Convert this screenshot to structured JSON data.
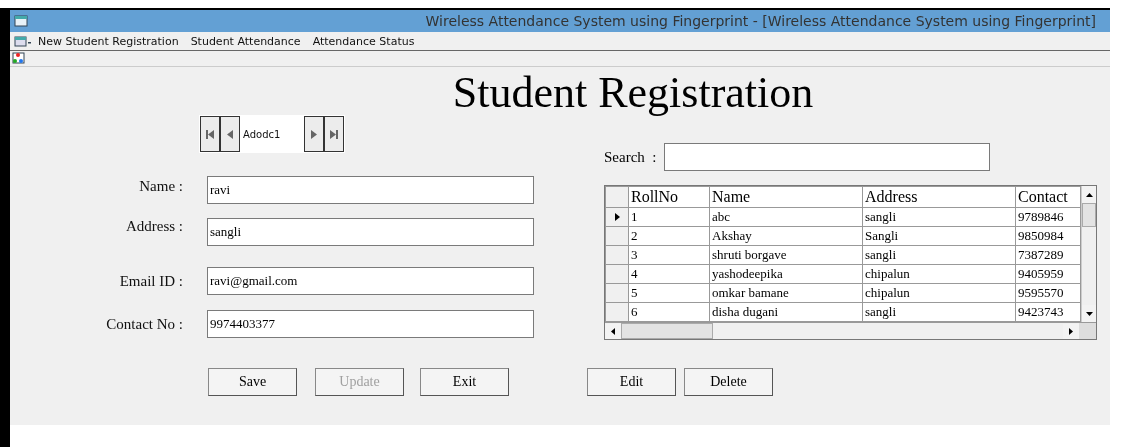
{
  "window": {
    "title": "Wireless Attendance System using Fingerprint - [Wireless Attendance System using Fingerprint]"
  },
  "menu": [
    "New Student Registration",
    "Student Attendance",
    "Attendance Status"
  ],
  "form_title": "Student Registration",
  "data_control": {
    "caption": "Adodc1"
  },
  "fields": [
    {
      "label": "Name :",
      "value": "ravi"
    },
    {
      "label": "Address :",
      "value": "sangli"
    },
    {
      "label": "Email ID :",
      "value": "ravi@gmail.com"
    },
    {
      "label": "Contact No :",
      "value": "9974403377"
    }
  ],
  "search": {
    "label": "Search  :"
  },
  "grid": {
    "columns": [
      "RollNo",
      "Name",
      "Address",
      "Contact"
    ],
    "rows": [
      {
        "selected": true,
        "cells": [
          "1",
          "abc",
          "sangli",
          "9789846"
        ]
      },
      {
        "selected": false,
        "cells": [
          "2",
          "Akshay",
          "Sangli",
          "9850984"
        ]
      },
      {
        "selected": false,
        "cells": [
          "3",
          "shruti borgave",
          "sangli",
          "7387289"
        ]
      },
      {
        "selected": false,
        "cells": [
          "4",
          "yashodeepika",
          "chipalun",
          "9405959"
        ]
      },
      {
        "selected": false,
        "cells": [
          "5",
          "omkar bamane",
          "chipalun",
          "9595570"
        ]
      },
      {
        "selected": false,
        "cells": [
          "6",
          "disha dugani",
          "sangli",
          "9423743"
        ]
      }
    ]
  },
  "buttons": [
    {
      "label": "Save",
      "disabled": false
    },
    {
      "label": "Update",
      "disabled": true
    },
    {
      "label": "Exit",
      "disabled": false
    },
    {
      "label": "Edit",
      "disabled": false
    },
    {
      "label": "Delete",
      "disabled": false
    }
  ]
}
